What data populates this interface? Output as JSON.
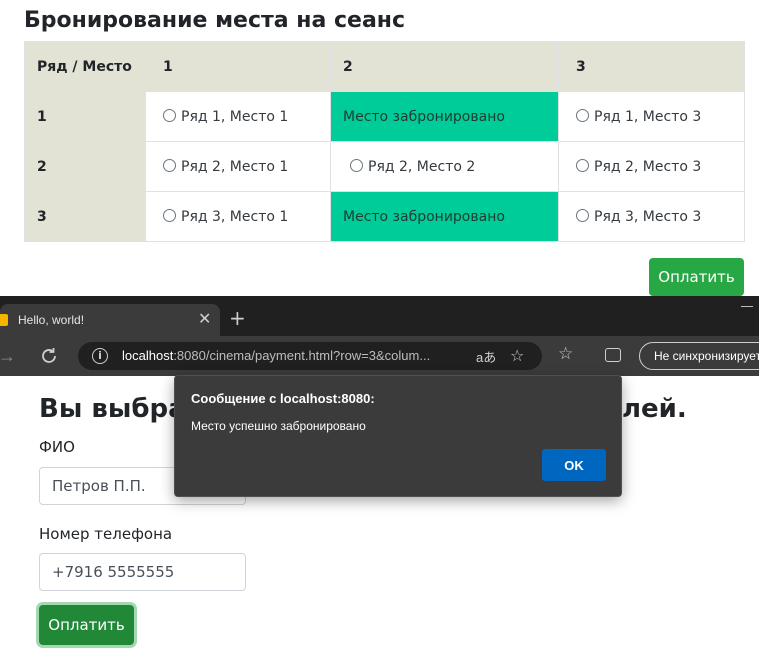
{
  "booking": {
    "title": "Бронирование места на сеанс",
    "header": {
      "corner": "Ряд / Место",
      "cols": [
        "1",
        "2",
        "3"
      ]
    },
    "rows": [
      {
        "label": "1",
        "cells": [
          {
            "text": "Ряд 1, Место 1",
            "booked": false
          },
          {
            "text": "Место забронировано",
            "booked": true
          },
          {
            "text": "Ряд 1, Место 3",
            "booked": false
          }
        ]
      },
      {
        "label": "2",
        "cells": [
          {
            "text": "Ряд 2, Место 1",
            "booked": false
          },
          {
            "text": "Ряд 2, Место 2",
            "booked": false
          },
          {
            "text": "Ряд 2, Место 3",
            "booked": false
          }
        ]
      },
      {
        "label": "3",
        "cells": [
          {
            "text": "Ряд 3, Место 1",
            "booked": false
          },
          {
            "text": "Место забронировано",
            "booked": true
          },
          {
            "text": "Ряд 3, Место 3",
            "booked": false
          }
        ]
      }
    ],
    "pay_label": "Оплатить",
    "booked_color": "#00cc99"
  },
  "browser": {
    "tab_title": "Hello, world!",
    "url_host": "localhost",
    "url_rest": ":8080/cinema/payment.html?row=3&colum...",
    "read_aloud_glyph": "aあ",
    "sync_label": "Не синхронизирует"
  },
  "payment": {
    "heading": "Вы выбрал",
    "heading_tail": "лей.",
    "name_label": "ФИО",
    "name_value": "Петров П.П.",
    "phone_label": "Номер телефона",
    "phone_value": "+7916 5555555",
    "pay_label": "Оплатить"
  },
  "dialog": {
    "title": "Сообщение с localhost:8080:",
    "message": "Место успешно забронировано",
    "ok_label": "OK"
  }
}
